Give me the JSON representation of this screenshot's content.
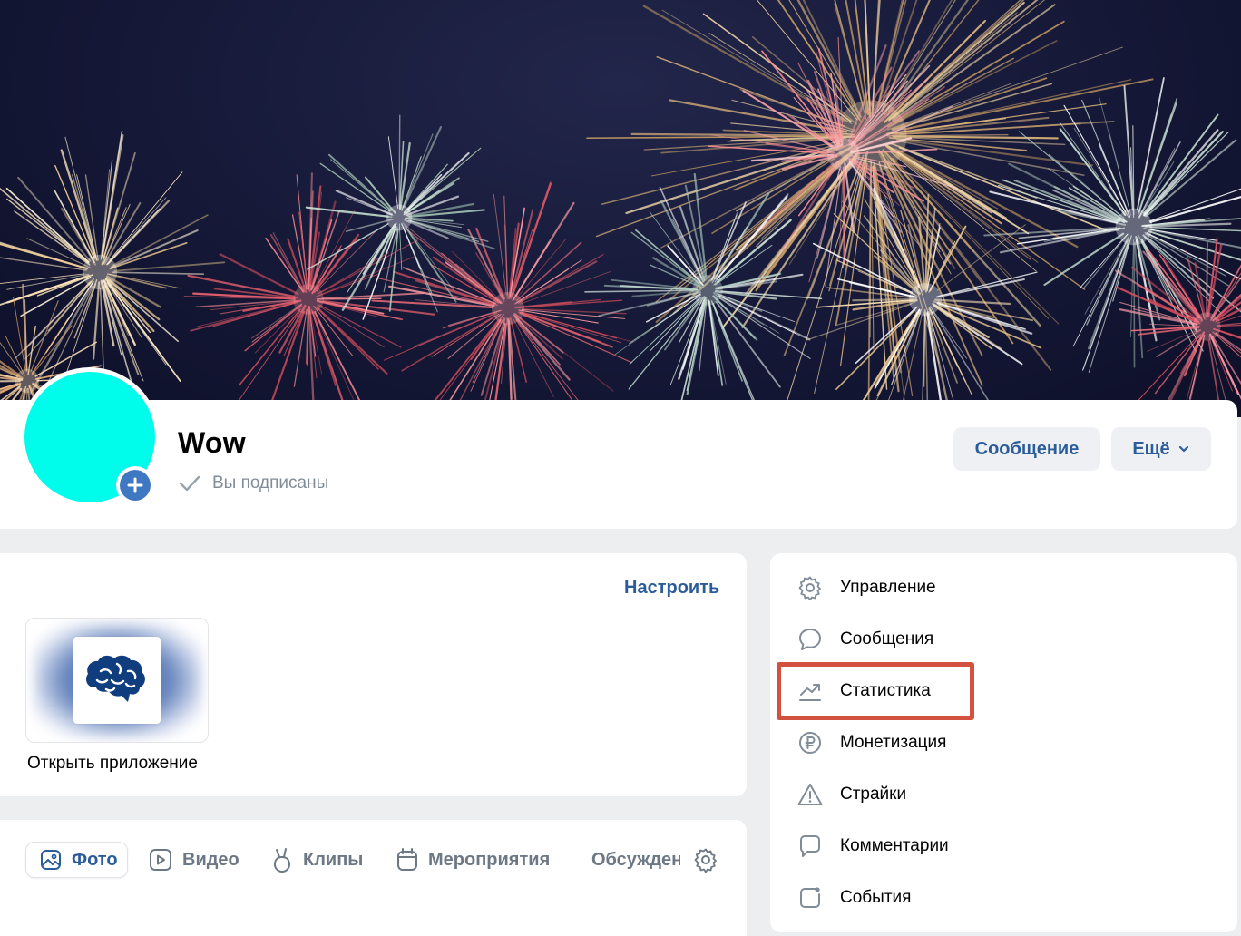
{
  "group": {
    "name": "Wow",
    "subscription_status": "Вы подписаны"
  },
  "actions": {
    "message_label": "Сообщение",
    "more_label": "Ещё"
  },
  "apps": {
    "configure_label": "Настроить",
    "open_app_label": "Открыть приложение"
  },
  "tabs": [
    {
      "label": "Фото",
      "icon": "photo-icon",
      "active": true
    },
    {
      "label": "Видео",
      "icon": "video-icon",
      "active": false
    },
    {
      "label": "Клипы",
      "icon": "clips-icon",
      "active": false
    },
    {
      "label": "Мероприятия",
      "icon": "calendar-icon",
      "active": false
    },
    {
      "label": "Обсуждения",
      "icon": "discussion-icon",
      "active": false
    }
  ],
  "menu": [
    {
      "label": "Управление",
      "icon": "gear-icon"
    },
    {
      "label": "Сообщения",
      "icon": "message-bubble-icon"
    },
    {
      "label": "Статистика",
      "icon": "stats-icon",
      "highlighted": true
    },
    {
      "label": "Монетизация",
      "icon": "ruble-icon"
    },
    {
      "label": "Страйки",
      "icon": "warning-icon"
    },
    {
      "label": "Комментарии",
      "icon": "comment-icon"
    },
    {
      "label": "События",
      "icon": "events-icon"
    }
  ],
  "colors": {
    "accent": "#2c5d9b",
    "avatar": "#00fdec",
    "highlight": "#d2513f",
    "page_bg": "#edeef0"
  }
}
